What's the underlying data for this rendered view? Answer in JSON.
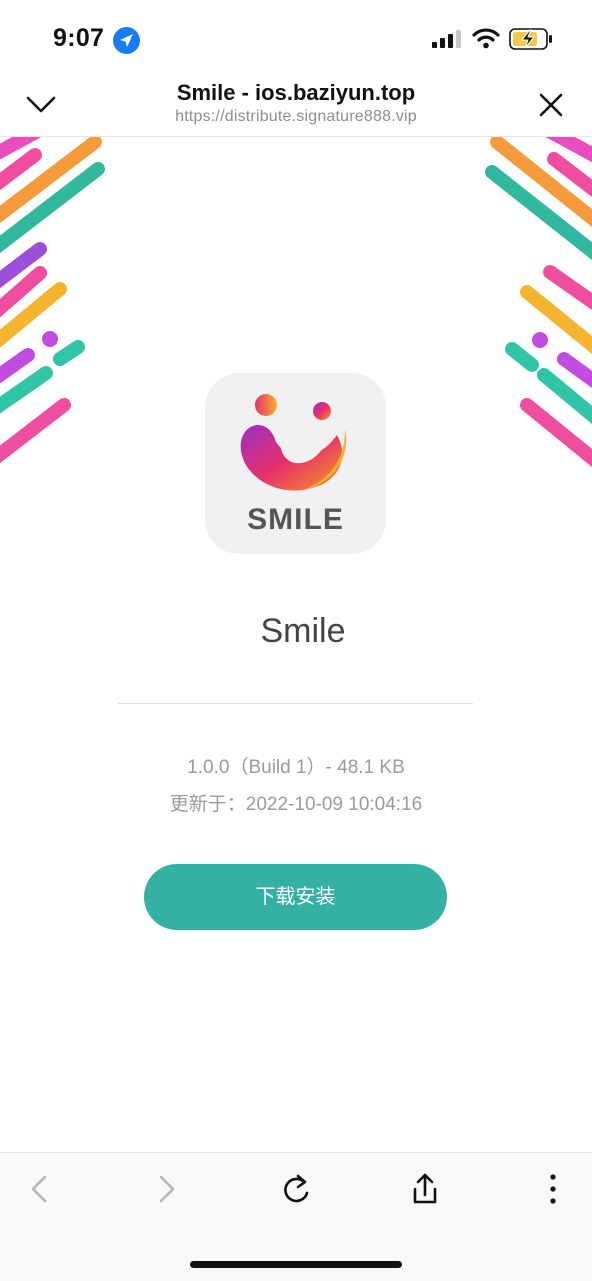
{
  "status_bar": {
    "time": "9:07"
  },
  "header": {
    "title": "Smile - ios.baziyun.top",
    "url": "https://distribute.signature888.vip"
  },
  "app": {
    "icon_label": "SMILE",
    "name": "Smile",
    "version_info": "1.0.0（Build 1）- 48.1 KB",
    "updated_at": "更新于：2022-10-09 10:04:16",
    "install_label": "下载安装"
  },
  "colors": {
    "install_button": "#34b1a4",
    "location_icon": "#1a7cf5",
    "battery_charging": "#f7c948"
  },
  "icons": {
    "collapse": "chevron-down-icon",
    "close": "close-icon",
    "back": "back-arrow-icon",
    "forward": "forward-arrow-icon",
    "reload": "reload-icon",
    "share": "share-icon",
    "more": "more-vertical-icon"
  }
}
